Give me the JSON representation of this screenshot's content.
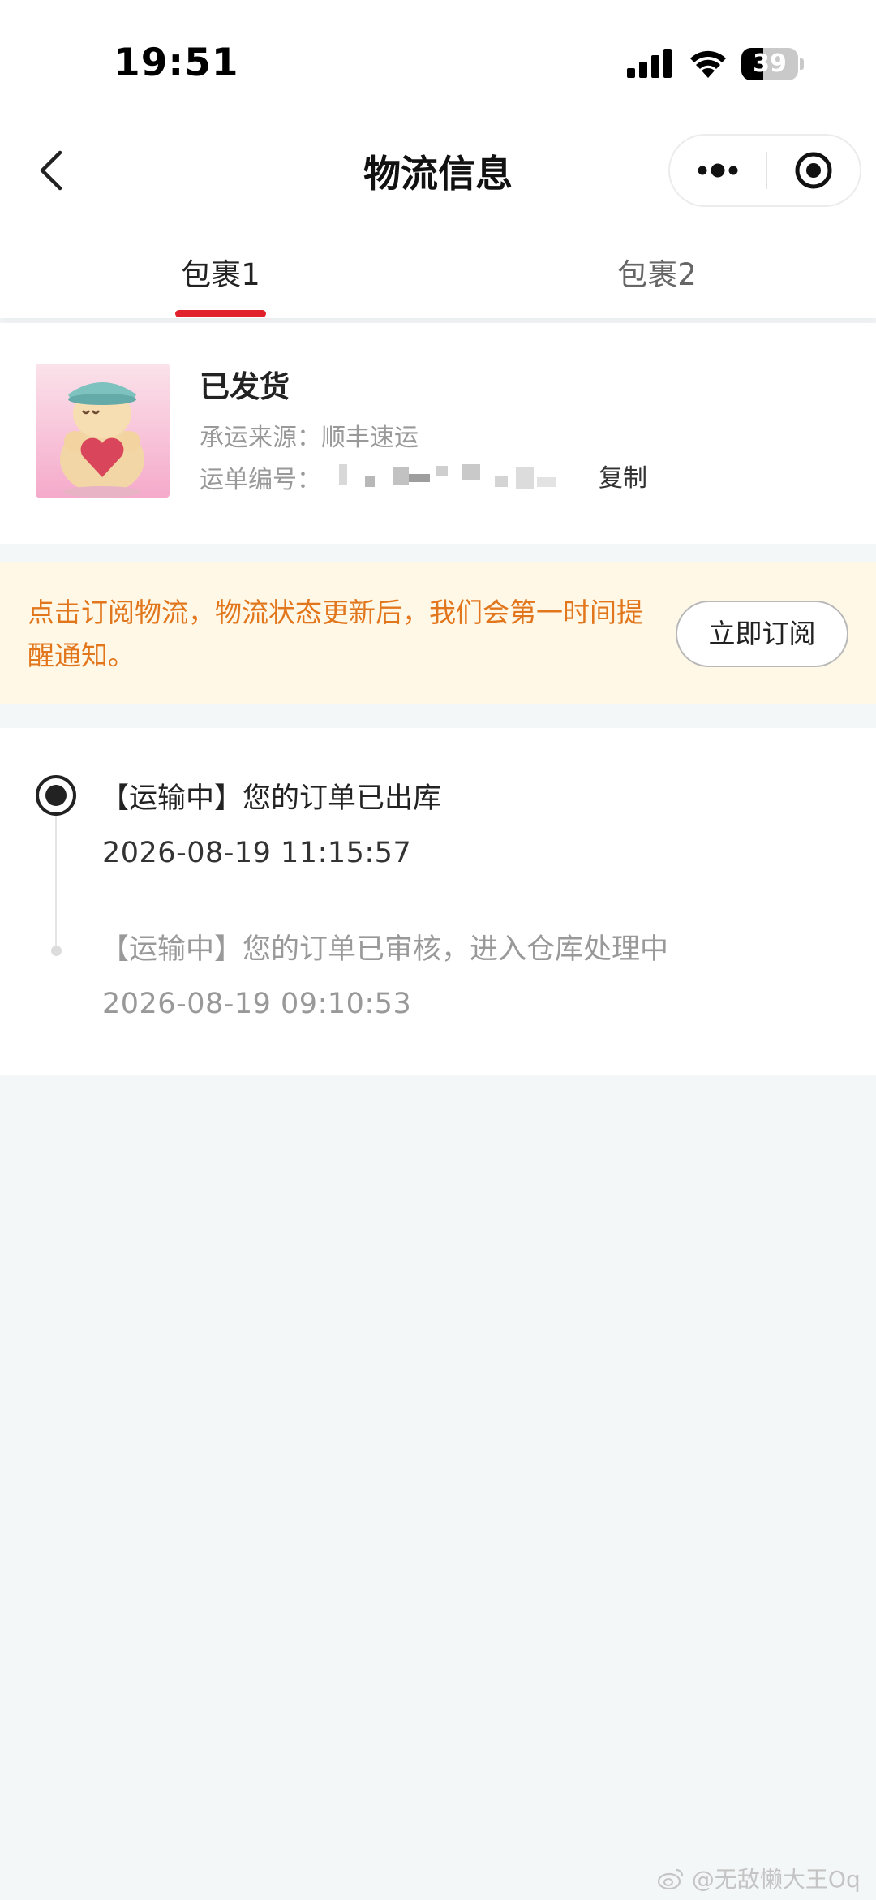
{
  "status_bar": {
    "time": "19:51",
    "battery": "39",
    "battery_level": 0.39
  },
  "nav": {
    "title": "物流信息"
  },
  "tabs": [
    {
      "label": "包裹1",
      "selected": true
    },
    {
      "label": "包裹2",
      "selected": false
    }
  ],
  "package": {
    "status": "已发货",
    "carrier_label": "承运来源：",
    "carrier": "顺丰速运",
    "waybill_label": "运单编号：",
    "copy_label": "复制"
  },
  "subscribe": {
    "text": "点击订阅物流，物流状态更新后，我们会第一时间提醒通知。",
    "button": "立即订阅"
  },
  "timeline": [
    {
      "title": "【运输中】您的订单已出库",
      "time": "2026-08-19 11:15:57",
      "active": true
    },
    {
      "title": "【运输中】您的订单已审核，进入仓库处理中",
      "time": "2026-08-19 09:10:53",
      "active": false
    }
  ],
  "watermark": "@无敌懒大王Oq",
  "colors": {
    "accent": "#e1212b",
    "notice_text": "#e2761c",
    "notice_bg": "#fff8e7",
    "page_bg": "#f4f7f8"
  }
}
